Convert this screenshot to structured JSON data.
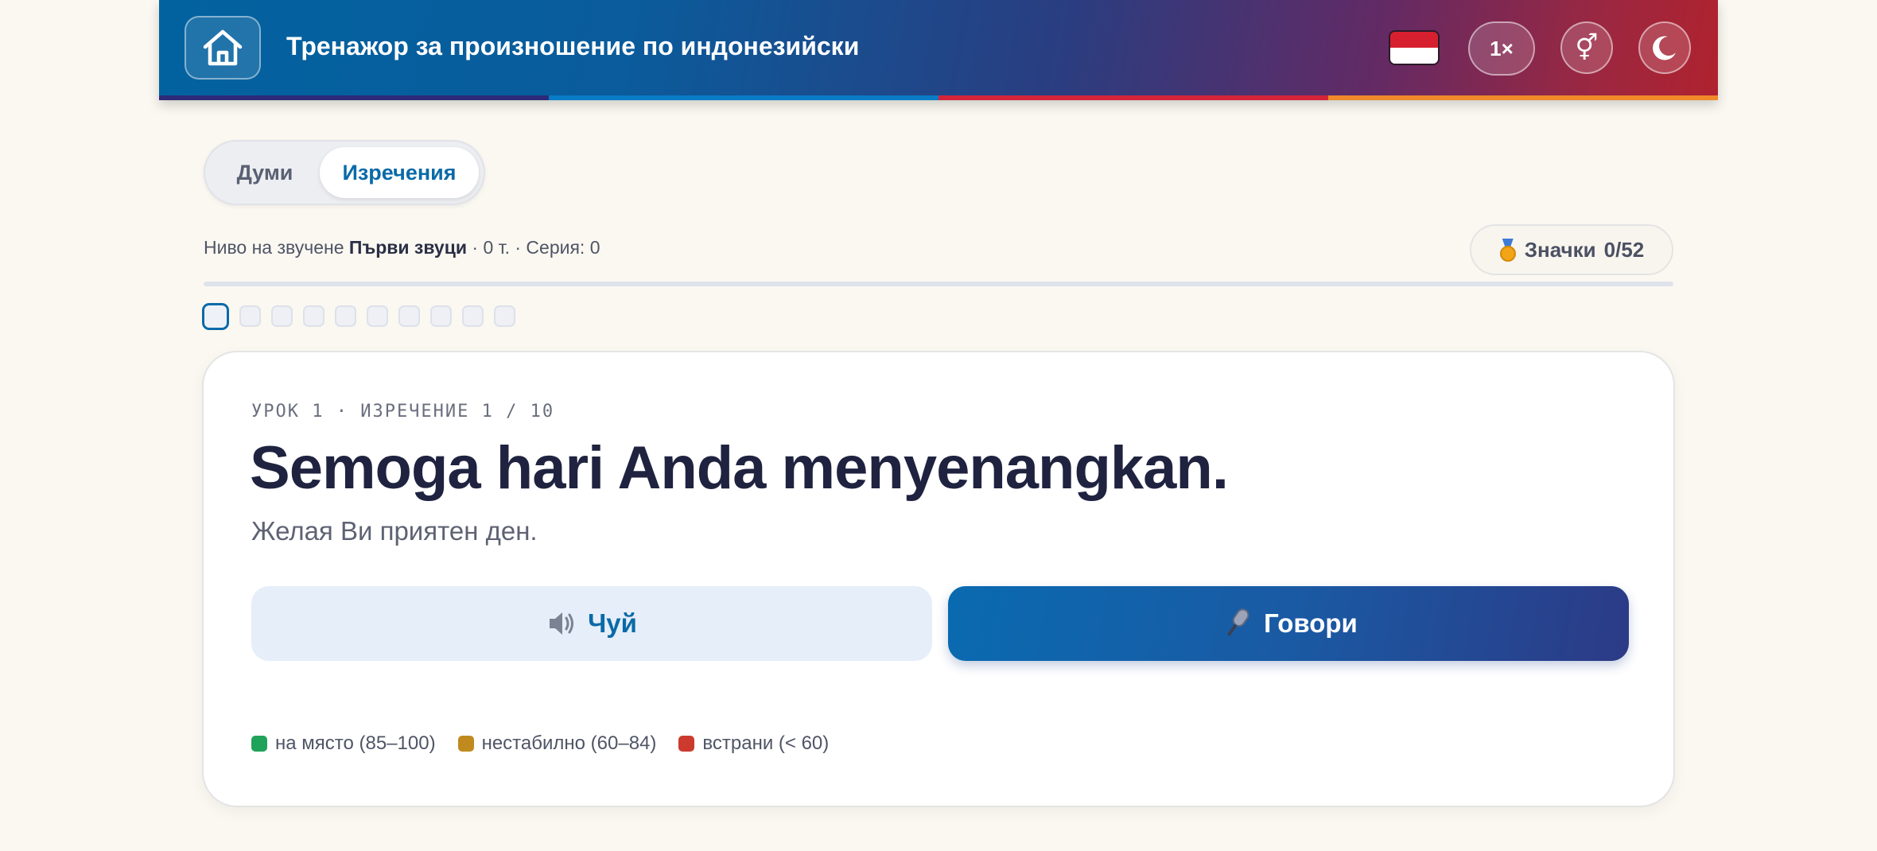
{
  "header": {
    "title": "Тренажор за произношение по индонезийски",
    "speed": "1×",
    "gender_symbol": "⚥",
    "stripe_colors": [
      "#2d2a7a",
      "#0a7bc6",
      "#d4243a",
      "#f0892a"
    ],
    "flag_colors": [
      "#d6202f",
      "#ffffff"
    ]
  },
  "tabs": [
    {
      "label": "Думи",
      "active": false
    },
    {
      "label": "Изречения",
      "active": true
    }
  ],
  "status": {
    "prefix": "Ниво на звучене ",
    "level": "Първи звуци",
    "suffix": " · 0 т. · Серия: 0",
    "badges_label": "Значки",
    "badges_count": "0/52",
    "progress": 0
  },
  "dots": {
    "total": 10,
    "current": 1
  },
  "card": {
    "lesson_label": "УРОК 1 · ИЗРЕЧЕНИЕ 1 / 10",
    "phrase": "Semoga hari Anda menyenangkan.",
    "translation": "Желая Ви приятен ден.",
    "listen_label": "Чуй",
    "speak_label": "Говори"
  },
  "legend": [
    {
      "label": "на място (85–100)",
      "color": "#1fa35a"
    },
    {
      "label": "нестабилно (60–84)",
      "color": "#c08a1e"
    },
    {
      "label": "встрани (< 60)",
      "color": "#cc3a2e"
    }
  ]
}
